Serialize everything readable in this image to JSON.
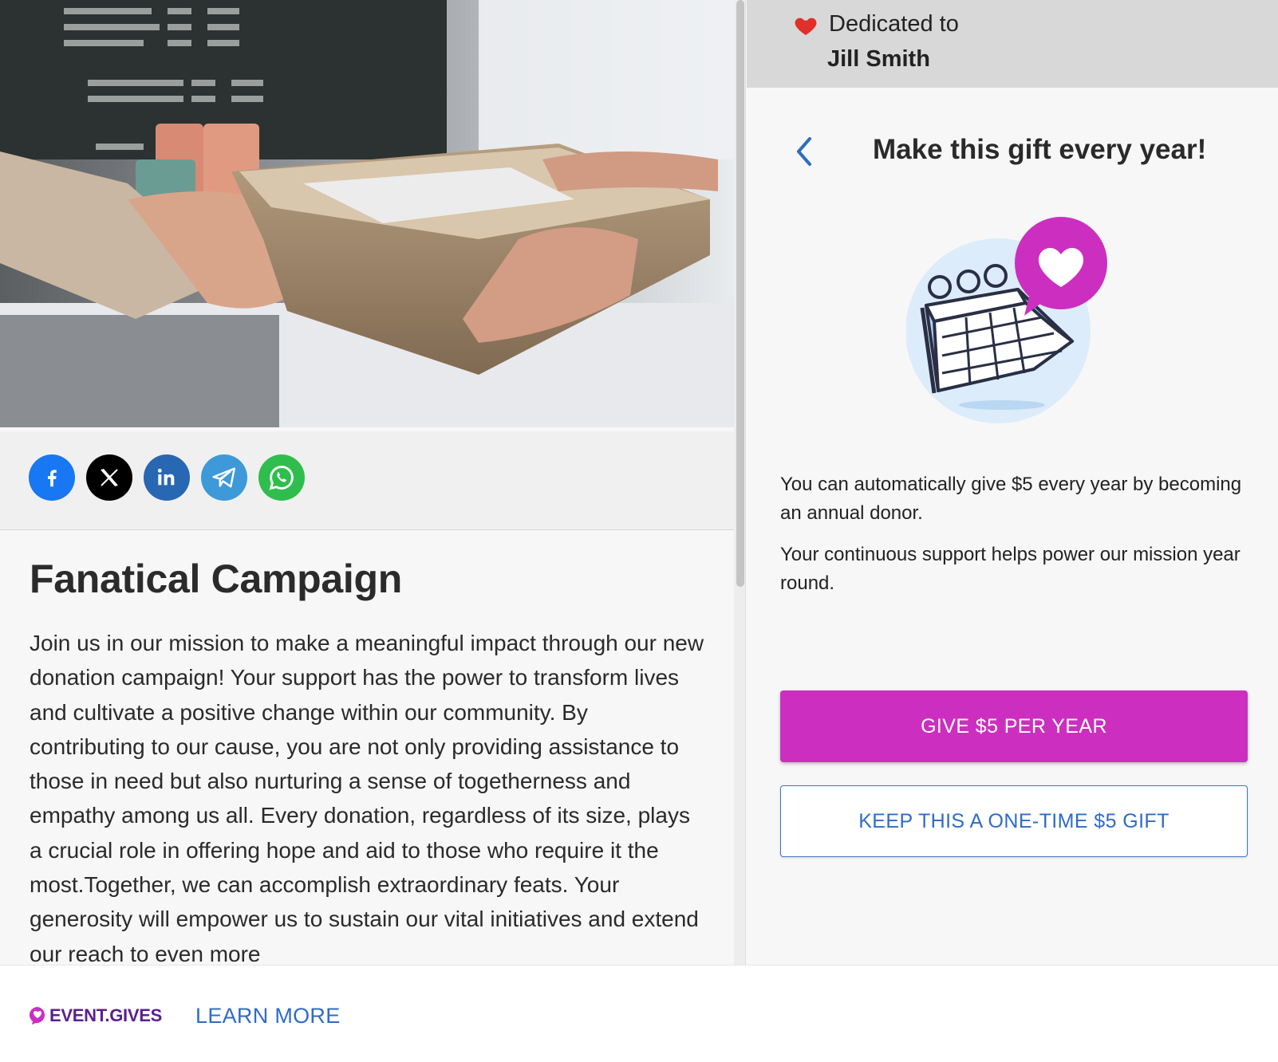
{
  "campaign": {
    "title": "Fanatical Campaign",
    "body": "Join us in our mission to make a meaningful impact through our new donation campaign! Your support has the power to transform lives and cultivate a positive change within our community. By contributing to our cause, you are not only providing assistance to those in need but also nurturing a sense of togetherness and empathy among us all. Every donation, regardless of its size, plays a crucial role in offering hope and aid to those who require it the most.Together, we can accomplish extraordinary feats. Your generosity will empower us to sustain our vital initiatives and extend our reach to even more"
  },
  "share": {
    "icons": [
      "facebook-icon",
      "x-icon",
      "linkedin-icon",
      "telegram-icon",
      "whatsapp-icon"
    ]
  },
  "dedication": {
    "label": "Dedicated to",
    "name": "Jill Smith",
    "icon": "heart-icon"
  },
  "panel": {
    "title": "Make this gift every year!",
    "desc1": "You can automatically give $5 every year by becoming an annual donor.",
    "desc2": "Your continuous support helps power our mission year round.",
    "give_label": "GIVE $5 PER YEAR",
    "onetime_label": "KEEP THIS A ONE-TIME $5 GIFT"
  },
  "footer": {
    "logo_text": "EVENT.GIVES",
    "learn_more": "LEARN MORE"
  },
  "colors": {
    "accent": "#cc2fbf",
    "link": "#2f6cc4",
    "brand": "#5b1f8f",
    "heart": "#e0302a"
  }
}
